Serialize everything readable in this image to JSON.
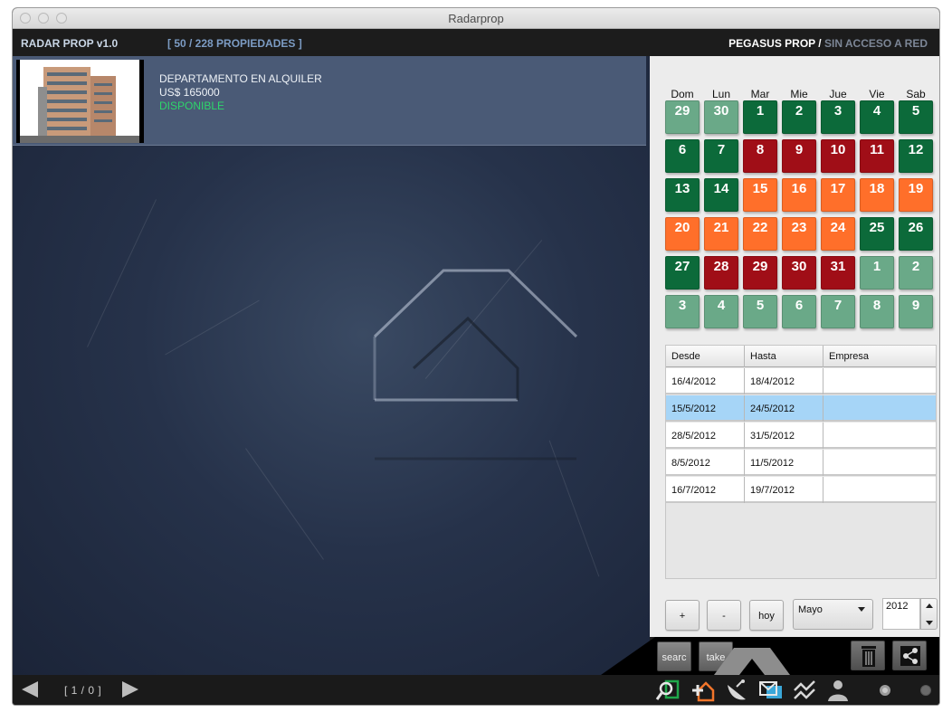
{
  "window": {
    "title": "Radarprop"
  },
  "header": {
    "brand": "RADAR PROP v1.0",
    "count": "[ 50 / 228 PROPIEDADES ]",
    "agency": "PEGASUS PROP",
    "separator": " / ",
    "network_status": "SIN ACCESO A RED"
  },
  "listing": {
    "type": "DEPARTAMENTO EN ALQUILER",
    "price": "US$ 165000",
    "status": "DISPONIBLE"
  },
  "calendar": {
    "weekdays": [
      "Dom",
      "Lun",
      "Mar",
      "Mie",
      "Jue",
      "Vie",
      "Sab"
    ],
    "colors": {
      "other_month": "#6aa988",
      "available": "#0c6a3a",
      "booked": "#a00e17",
      "reserved": "#ff6f2a"
    },
    "days": [
      {
        "label": "29",
        "state": "other"
      },
      {
        "label": "30",
        "state": "other"
      },
      {
        "label": "1",
        "state": "green"
      },
      {
        "label": "2",
        "state": "green"
      },
      {
        "label": "3",
        "state": "green"
      },
      {
        "label": "4",
        "state": "green"
      },
      {
        "label": "5",
        "state": "green"
      },
      {
        "label": "6",
        "state": "green"
      },
      {
        "label": "7",
        "state": "green"
      },
      {
        "label": "8",
        "state": "red"
      },
      {
        "label": "9",
        "state": "red"
      },
      {
        "label": "10",
        "state": "red"
      },
      {
        "label": "11",
        "state": "red"
      },
      {
        "label": "12",
        "state": "green"
      },
      {
        "label": "13",
        "state": "green"
      },
      {
        "label": "14",
        "state": "green"
      },
      {
        "label": "15",
        "state": "orange"
      },
      {
        "label": "16",
        "state": "orange"
      },
      {
        "label": "17",
        "state": "orange"
      },
      {
        "label": "18",
        "state": "orange"
      },
      {
        "label": "19",
        "state": "orange"
      },
      {
        "label": "20",
        "state": "orange"
      },
      {
        "label": "21",
        "state": "orange"
      },
      {
        "label": "22",
        "state": "orange"
      },
      {
        "label": "23",
        "state": "orange"
      },
      {
        "label": "24",
        "state": "orange"
      },
      {
        "label": "25",
        "state": "green"
      },
      {
        "label": "26",
        "state": "green"
      },
      {
        "label": "27",
        "state": "green"
      },
      {
        "label": "28",
        "state": "red"
      },
      {
        "label": "29",
        "state": "red"
      },
      {
        "label": "30",
        "state": "red"
      },
      {
        "label": "31",
        "state": "red"
      },
      {
        "label": "1",
        "state": "other"
      },
      {
        "label": "2",
        "state": "other"
      },
      {
        "label": "3",
        "state": "other"
      },
      {
        "label": "4",
        "state": "other"
      },
      {
        "label": "5",
        "state": "other"
      },
      {
        "label": "6",
        "state": "other"
      },
      {
        "label": "7",
        "state": "other"
      },
      {
        "label": "8",
        "state": "other"
      },
      {
        "label": "9",
        "state": "other"
      }
    ]
  },
  "reservations": {
    "columns": [
      "Desde",
      "Hasta",
      "Empresa"
    ],
    "rows": [
      {
        "desde": "16/4/2012",
        "hasta": "18/4/2012",
        "empresa": "",
        "selected": false
      },
      {
        "desde": "15/5/2012",
        "hasta": "24/5/2012",
        "empresa": "",
        "selected": true
      },
      {
        "desde": "28/5/2012",
        "hasta": "31/5/2012",
        "empresa": "",
        "selected": false
      },
      {
        "desde": "8/5/2012",
        "hasta": "11/5/2012",
        "empresa": "",
        "selected": false
      },
      {
        "desde": "16/7/2012",
        "hasta": "19/7/2012",
        "empresa": "",
        "selected": false
      }
    ]
  },
  "controls": {
    "plus_label": "+",
    "minus_label": "-",
    "today_label": "hoy",
    "month_value": "Mayo",
    "year_value": "2012"
  },
  "actions": {
    "search_label": "searc",
    "take_label": "take"
  },
  "footer": {
    "pager": "[ 1 / 0 ]",
    "icons": [
      "search-icon",
      "add-property-icon",
      "satellite-icon",
      "mail-icon",
      "stats-icon",
      "user-icon"
    ]
  }
}
